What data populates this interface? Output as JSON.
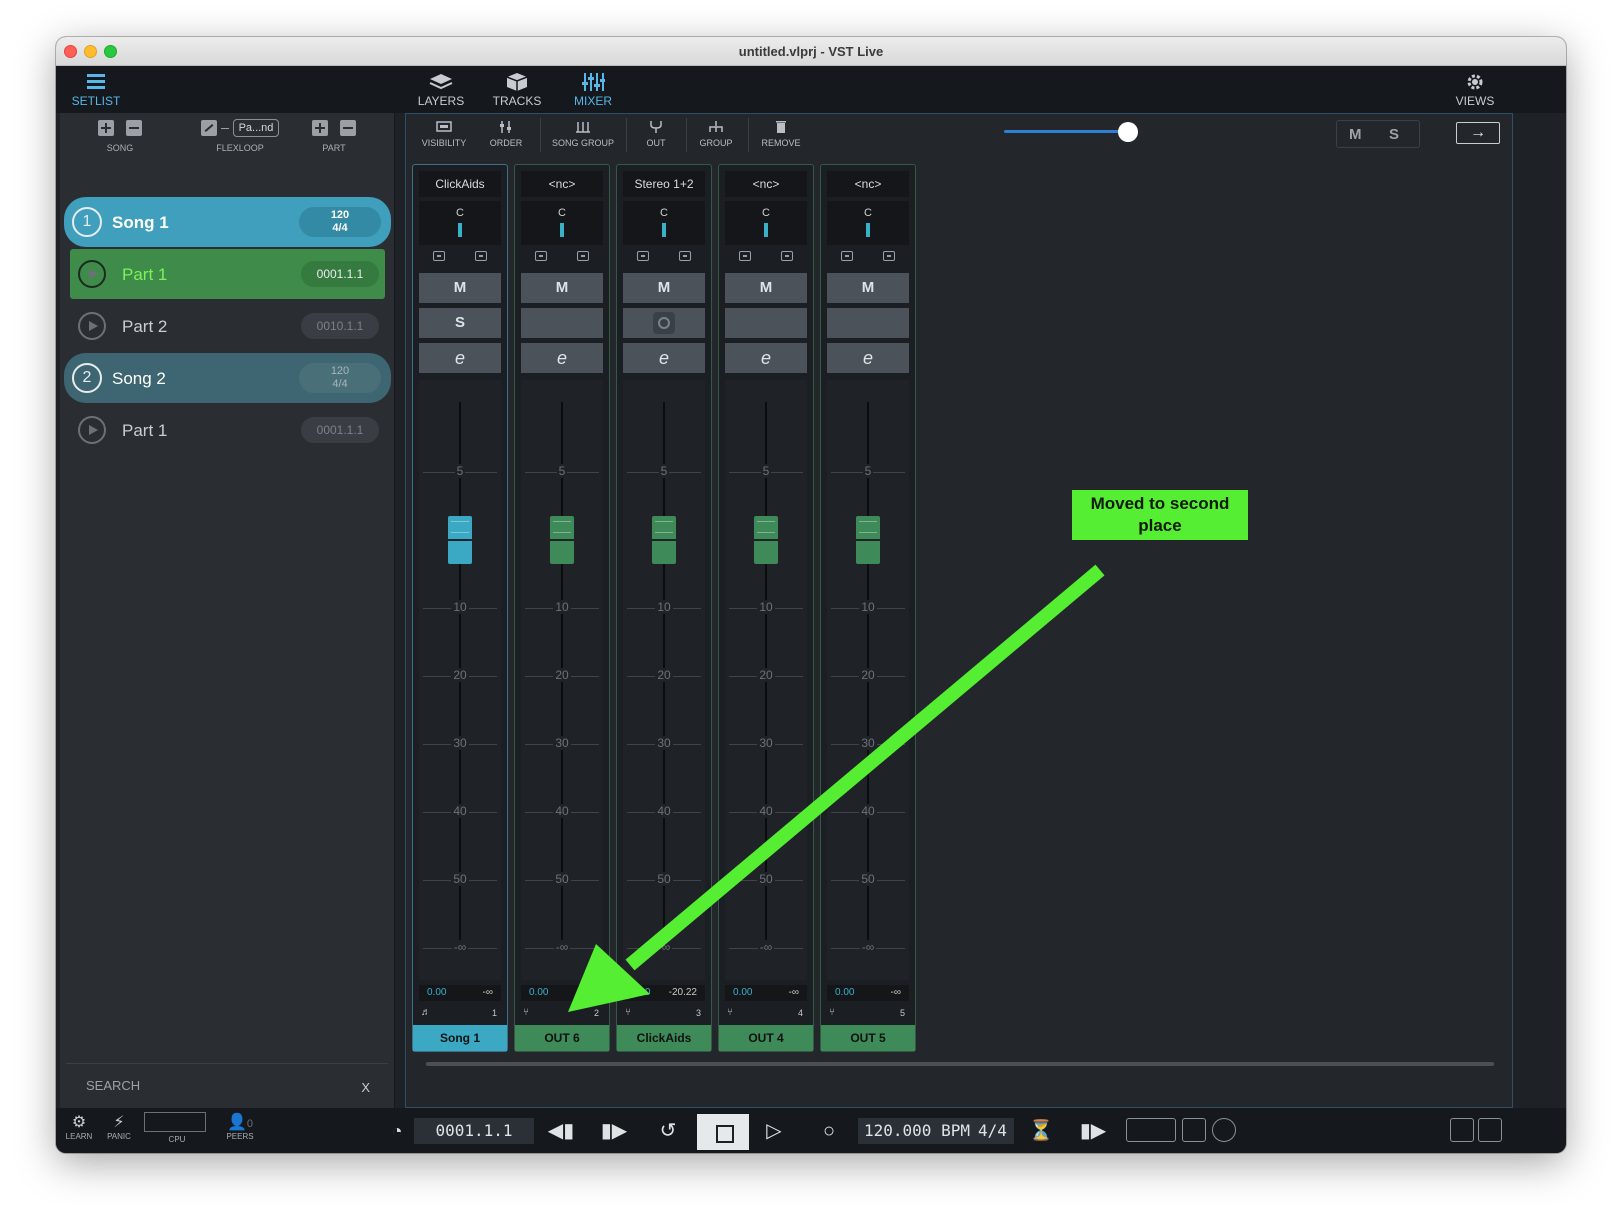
{
  "window": {
    "title": "untitled.vlprj - VST Live"
  },
  "topbar": {
    "setlist": {
      "label": "SETLIST",
      "icon": "list-icon"
    },
    "layers": {
      "label": "LAYERS",
      "icon": "layers-icon"
    },
    "tracks": {
      "label": "TRACKS",
      "icon": "cube-icon"
    },
    "mixer": {
      "label": "MIXER",
      "icon": "mixer-icon"
    },
    "views": {
      "label": "VIEWS",
      "icon": "gear-icon"
    }
  },
  "left_toolbar": {
    "song_label": "SONG",
    "flexloop_label": "FLEXLOOP",
    "flexloop_value": "Pa...nd",
    "part_label": "PART"
  },
  "setlist": [
    {
      "kind": "song",
      "number": "1",
      "name": "Song 1",
      "tempo": "120",
      "sig": "4/4"
    },
    {
      "kind": "part",
      "name": "Part  1",
      "position": "0001.1.1",
      "active": true
    },
    {
      "kind": "part",
      "name": "Part  2",
      "position": "0010.1.1",
      "active": false
    },
    {
      "kind": "song",
      "number": "2",
      "name": "Song 2",
      "tempo": "120",
      "sig": "4/4"
    },
    {
      "kind": "part",
      "name": "Part  1",
      "position": "0001.1.1",
      "active": false
    }
  ],
  "search": {
    "placeholder": "SEARCH",
    "clear": "X"
  },
  "mixer_toolbar": {
    "visibility": "VISIBILITY",
    "order": "ORDER",
    "song_group": "SONG GROUP",
    "out": "OUT",
    "group": "GROUP",
    "remove": "REMOVE",
    "m": "M",
    "s": "S",
    "arrow": "→"
  },
  "fader_scale": [
    "5",
    "10",
    "20",
    "30",
    "40",
    "50",
    "-∞"
  ],
  "fader_scale_db": [
    5,
    10,
    20,
    30,
    40,
    50,
    "-inf"
  ],
  "channels": [
    {
      "input": "ClickAids",
      "pan": "C",
      "mute": "M",
      "solo": "S",
      "solo_kind": "text",
      "edit": "e",
      "volume": "0.00",
      "meter": "-∞",
      "icon": "♬",
      "number": "1",
      "name": "Song 1",
      "fader_db": 0,
      "color": "#3ba9c4"
    },
    {
      "input": "<nc>",
      "pan": "C",
      "mute": "M",
      "solo": "",
      "solo_kind": "none",
      "edit": "e",
      "volume": "0.00",
      "meter": "-∞",
      "icon": "⑂",
      "number": "2",
      "name": "OUT 6",
      "fader_db": 0,
      "color": "#3e8a58"
    },
    {
      "input": "Stereo 1+2",
      "pan": "C",
      "mute": "M",
      "solo": "",
      "solo_kind": "listen",
      "edit": "e",
      "volume": "0.00",
      "meter": "-20.22",
      "icon": "⑂",
      "number": "3",
      "name": "ClickAids",
      "fader_db": 0,
      "color": "#3e8a58"
    },
    {
      "input": "<nc>",
      "pan": "C",
      "mute": "M",
      "solo": "",
      "solo_kind": "none",
      "edit": "e",
      "volume": "0.00",
      "meter": "-∞",
      "icon": "⑂",
      "number": "4",
      "name": "OUT 4",
      "fader_db": 0,
      "color": "#3e8a58"
    },
    {
      "input": "<nc>",
      "pan": "C",
      "mute": "M",
      "solo": "",
      "solo_kind": "none",
      "edit": "e",
      "volume": "0.00",
      "meter": "-∞",
      "icon": "⑂",
      "number": "5",
      "name": "OUT 5",
      "fader_db": 0,
      "color": "#3e8a58"
    }
  ],
  "annotation": {
    "text": "Moved to second place",
    "color": "#55ee33"
  },
  "transport": {
    "learn": "LEARN",
    "panic": "PANIC",
    "cpu": "CPU",
    "peers": "PEERS",
    "peers_count": "0",
    "position": "0001.1.1",
    "bpm": "120.000 BPM",
    "signature": "4/4"
  }
}
